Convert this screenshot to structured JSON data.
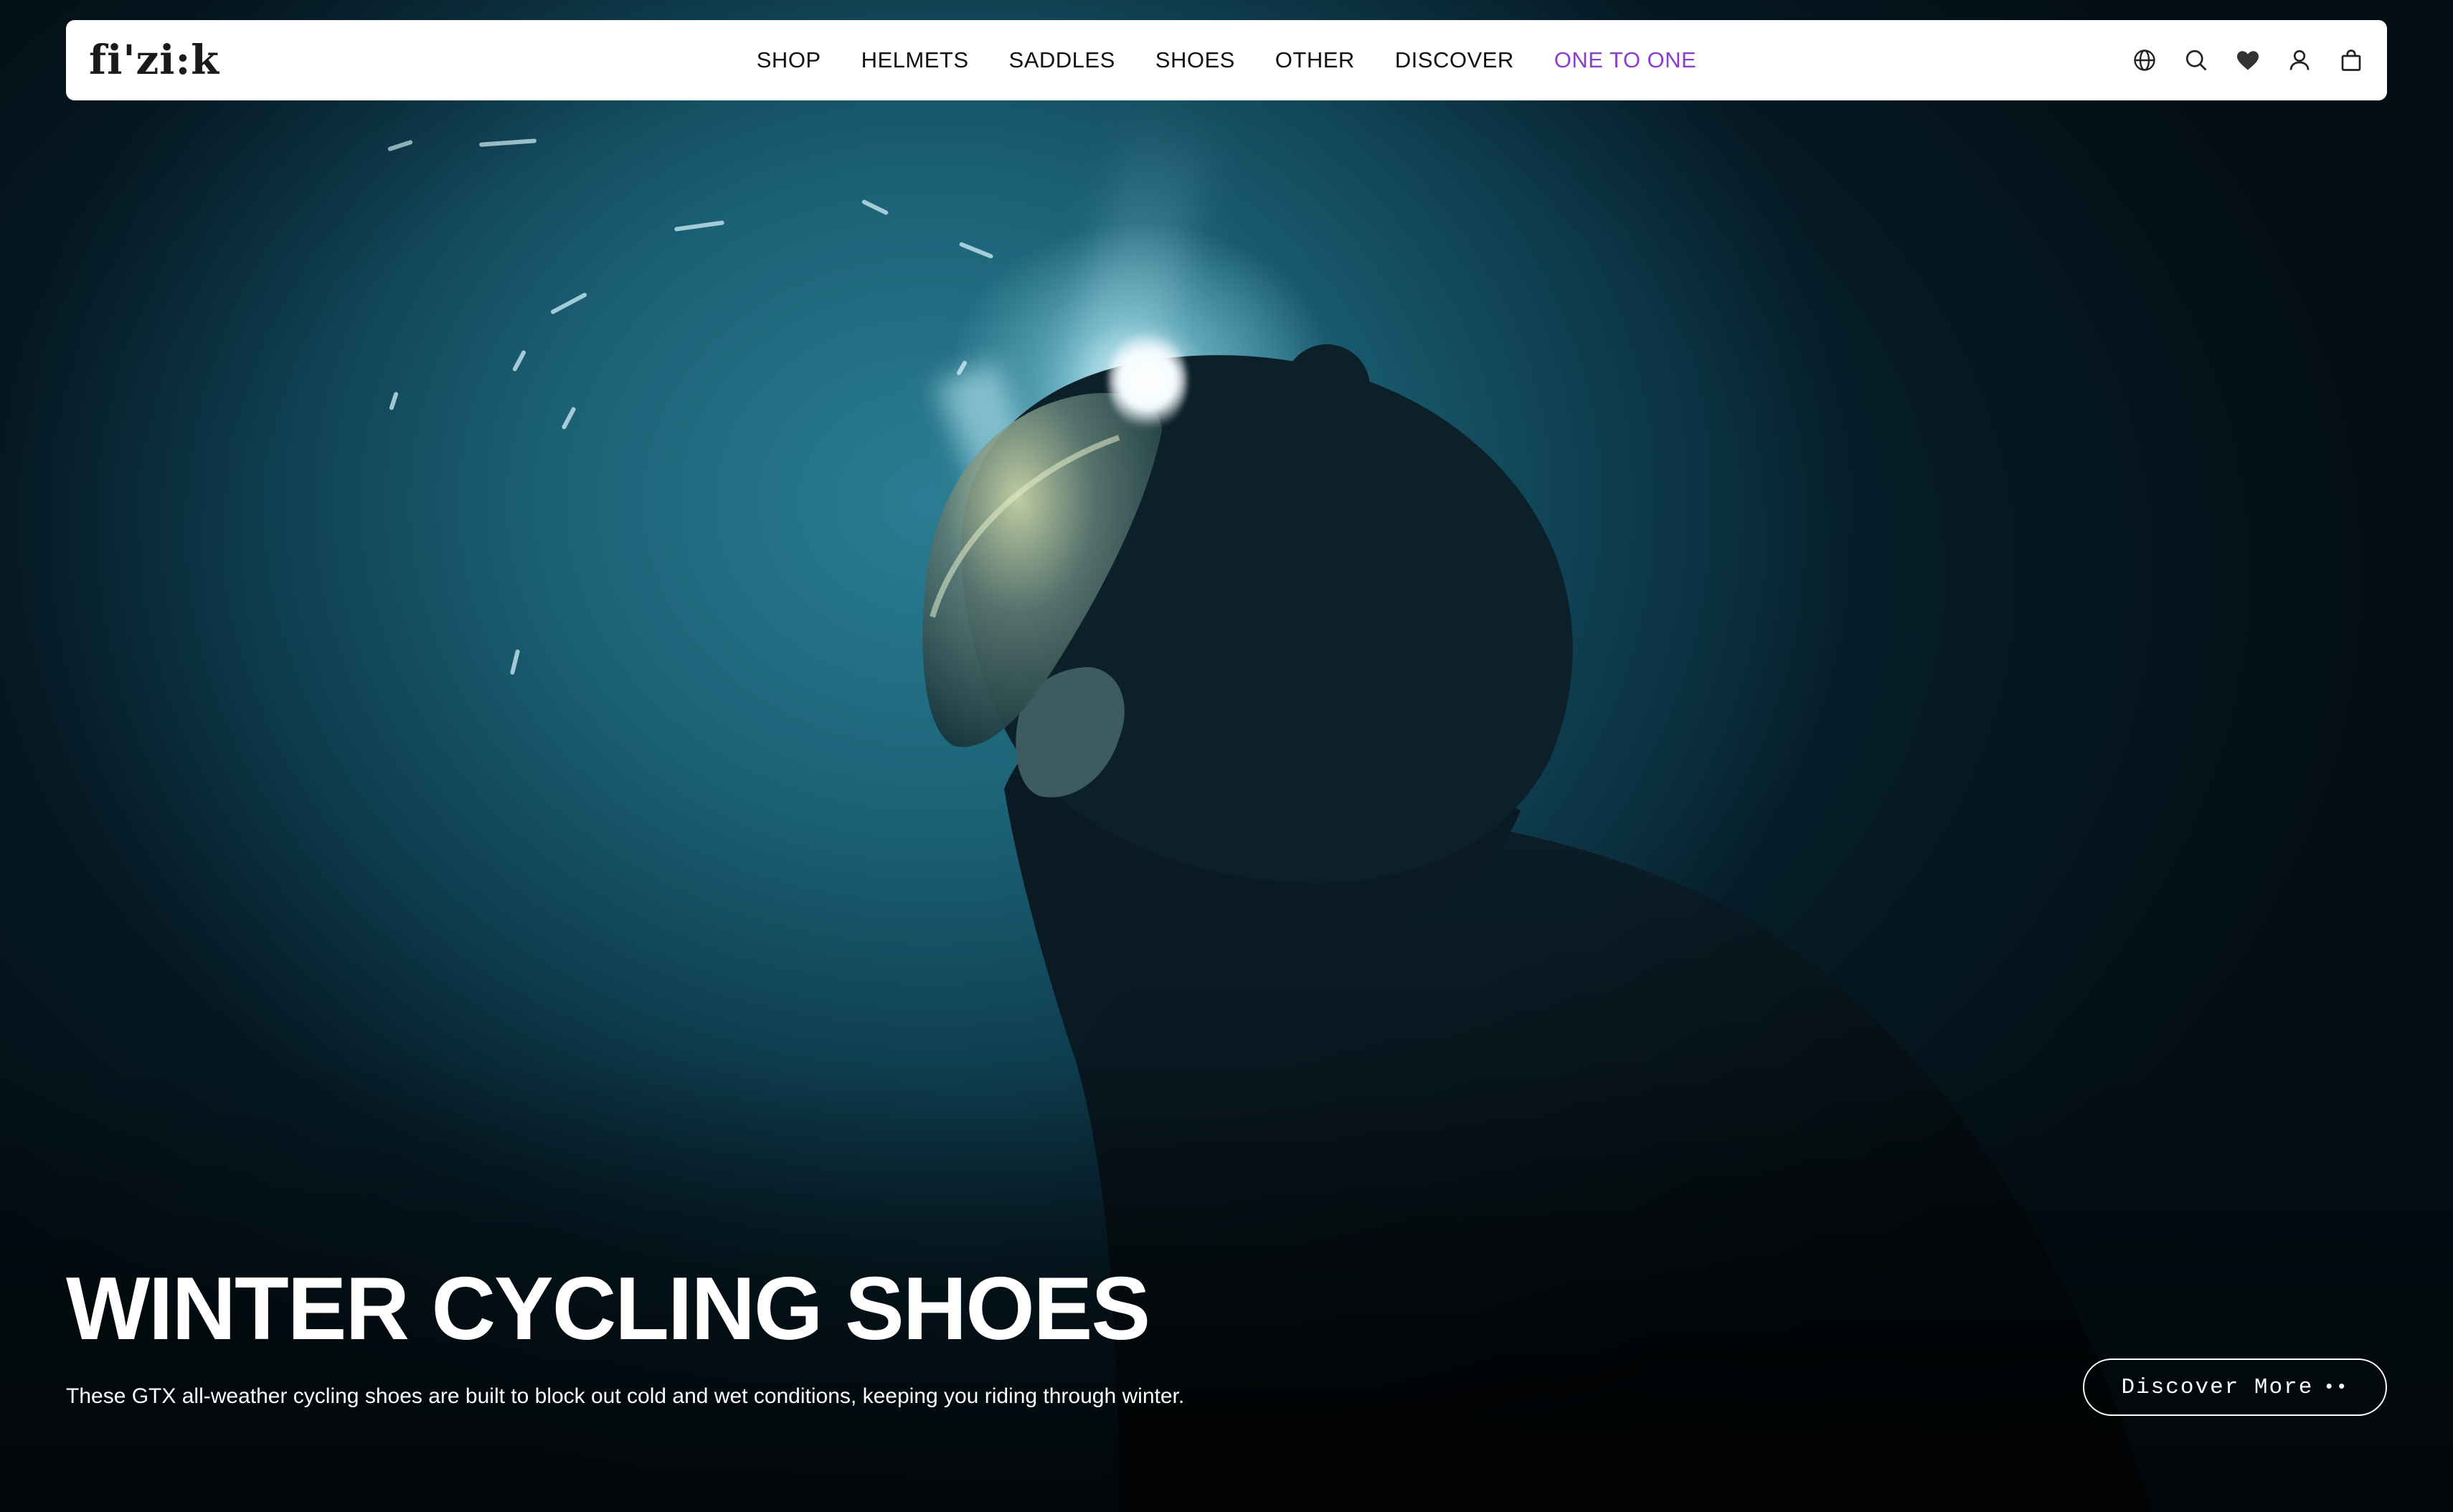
{
  "brand": {
    "logo_text": "fi'zi:k"
  },
  "nav": {
    "items": [
      {
        "label": "SHOP"
      },
      {
        "label": "HELMETS"
      },
      {
        "label": "SADDLES"
      },
      {
        "label": "SHOES"
      },
      {
        "label": "OTHER"
      },
      {
        "label": "DISCOVER"
      },
      {
        "label": "ONE TO ONE"
      }
    ],
    "accent_color": "#8a3fd0",
    "icons": [
      "globe-icon",
      "search-icon",
      "heart-icon",
      "user-icon",
      "bag-icon"
    ]
  },
  "hero": {
    "headline": "WINTER CYCLING SHOES",
    "subtitle": "These GTX all-weather cycling shoes are built to block out cold and wet conditions, keeping you riding through winter.",
    "cta_label": "Discover More",
    "cta_dots": "••"
  }
}
